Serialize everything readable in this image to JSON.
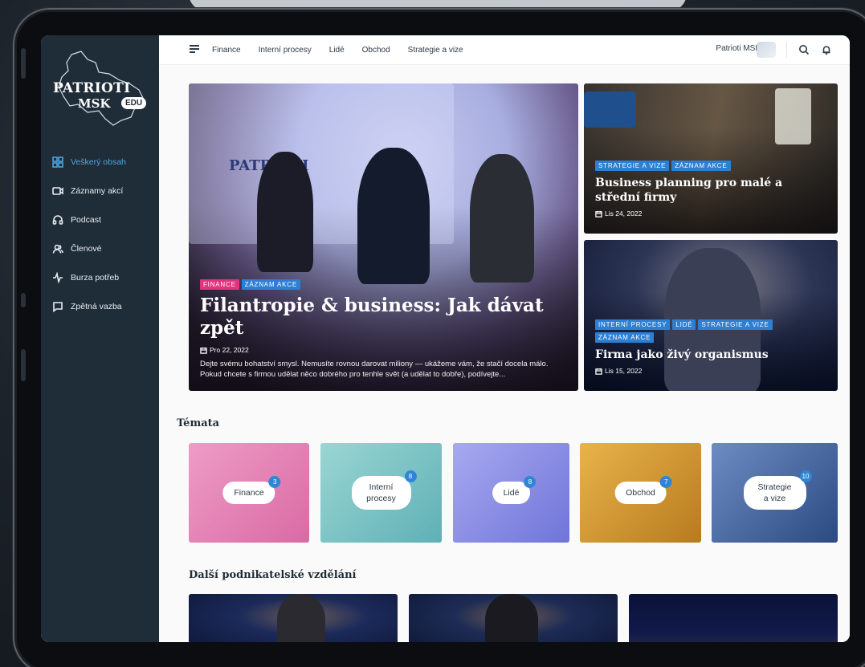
{
  "app": {
    "logo_line1": "PATRIOTI",
    "logo_line2": "MSK",
    "logo_badge": "EDU"
  },
  "sidebar": {
    "items": [
      {
        "label": "Veškerý obsah",
        "icon": "grid-icon",
        "active": true
      },
      {
        "label": "Záznamy akcí",
        "icon": "video-camera-icon",
        "active": false
      },
      {
        "label": "Podcast",
        "icon": "headphones-icon",
        "active": false
      },
      {
        "label": "Členové",
        "icon": "users-icon",
        "active": false
      },
      {
        "label": "Burza potřeb",
        "icon": "activity-icon",
        "active": false
      },
      {
        "label": "Zpětná vazba",
        "icon": "message-icon",
        "active": false
      }
    ]
  },
  "topbar": {
    "nav": [
      "Finance",
      "Interní procesy",
      "Lidé",
      "Obchod",
      "Strategie a vize"
    ],
    "user_name": "Patrioti MSK",
    "icons": [
      "menu-icon",
      "chevron-down-icon",
      "search-icon",
      "bell-icon"
    ]
  },
  "hero": {
    "main": {
      "tags": [
        "FINANCE",
        "ZÁZNAM AKCE"
      ],
      "title": "Filantropie & business: Jak dávat zpět",
      "date": "Pro 22, 2022",
      "excerpt": "Dejte svému bohatství smysl. Nemusíte rovnou darovat miliony — ukážeme vám, že stačí docela málo. Pokud chcete s firmou udělat něco dobrého pro tenhle svět (a udělat to dobře), podívejte..."
    },
    "side1": {
      "tags": [
        "STRATEGIE A VIZE",
        "ZÁZNAM AKCE"
      ],
      "title": "Business planning pro malé a střední firmy",
      "date": "Lis 24, 2022"
    },
    "side2": {
      "tags": [
        "INTERNÍ PROCESY",
        "LIDÉ",
        "STRATEGIE A VIZE",
        "ZÁZNAM AKCE"
      ],
      "title": "Firma jako živý organismus",
      "date": "Lis 15, 2022"
    },
    "banner_text": "PATRIOTI"
  },
  "topics": {
    "title": "Témata",
    "items": [
      {
        "label": "Finance",
        "count": "3",
        "color": "#e785b8"
      },
      {
        "label": "Interní procesy",
        "count": "8",
        "color": "#7fc8c8"
      },
      {
        "label": "Lidé",
        "count": "8",
        "color": "#8c8fe6"
      },
      {
        "label": "Obchod",
        "count": "7",
        "color": "#e0a73f"
      },
      {
        "label": "Strategie a vize",
        "count": "10",
        "color": "#4d6fa8"
      }
    ]
  },
  "further": {
    "title": "Další podnikatelské vzdělání"
  }
}
